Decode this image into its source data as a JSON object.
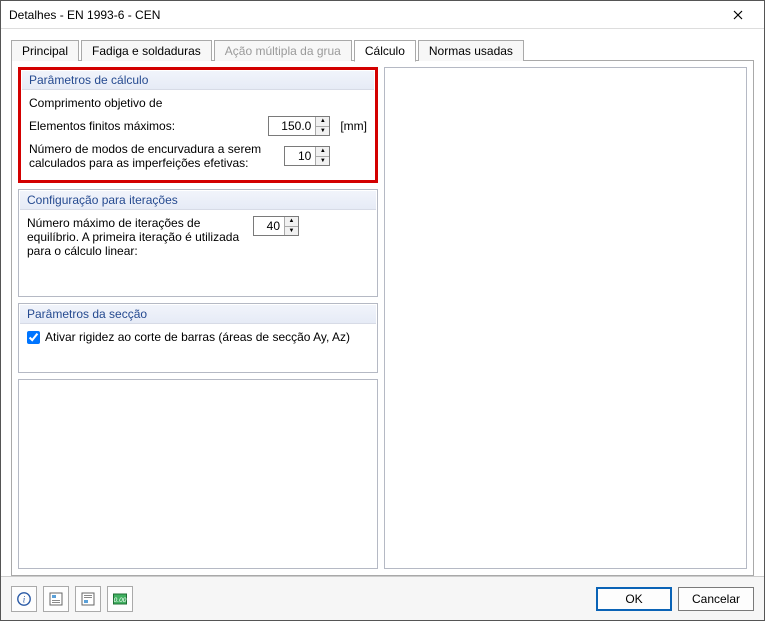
{
  "window": {
    "title": "Detalhes - EN 1993-6 - CEN"
  },
  "tabs": {
    "items": [
      {
        "label": "Principal"
      },
      {
        "label": "Fadiga e soldaduras"
      },
      {
        "label": "Ação múltipla da grua"
      },
      {
        "label": "Cálculo"
      },
      {
        "label": "Normas usadas"
      }
    ]
  },
  "group_calc": {
    "title": "Parâmetros de cálculo",
    "row1_label": "Comprimento objetivo de",
    "row2_label": "Elementos finitos máximos:",
    "row2_value": "150.0",
    "row2_unit": "[mm]",
    "row3_label": "Número de modos de encurvadura a serem calculados para as imperfeições efetivas:",
    "row3_value": "10"
  },
  "group_iter": {
    "title": "Configuração para iterações",
    "row1_label": "Número máximo de iterações de equilíbrio. A primeira iteração é utilizada para o cálculo linear:",
    "row1_value": "40"
  },
  "group_section": {
    "title": "Parâmetros da secção",
    "check_label": "Ativar rigidez ao corte de barras (áreas de secção Ay, Az)"
  },
  "footer": {
    "ok": "OK",
    "cancel": "Cancelar"
  }
}
